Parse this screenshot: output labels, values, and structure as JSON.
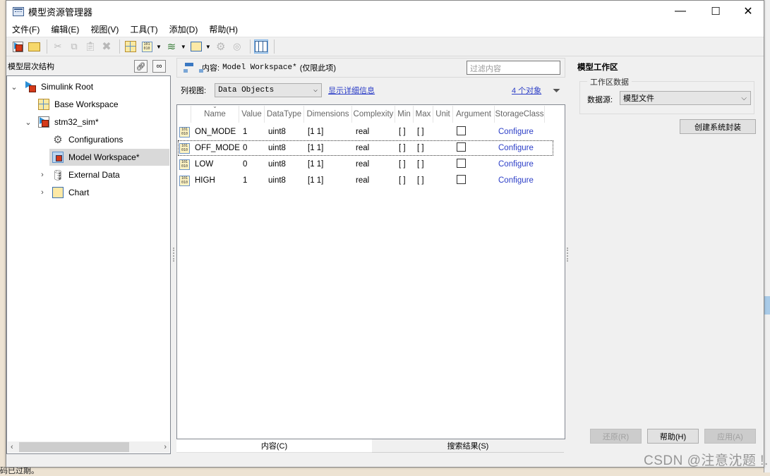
{
  "window": {
    "title": "模型资源管理器",
    "controls": {
      "minimize": "—",
      "maximize": "☐",
      "close": "✕"
    }
  },
  "menubar": [
    "文件(F)",
    "编辑(E)",
    "视图(V)",
    "工具(T)",
    "添加(D)",
    "帮助(H)"
  ],
  "toolbar": {
    "icons": [
      "new-model-icon",
      "open-folder-icon",
      "cut-icon",
      "copy-icon",
      "paste-icon",
      "delete-icon",
      "base-workspace-icon",
      "add-data-icon",
      "add-signal-icon",
      "add-block-icon",
      "config-icon",
      "config-ref-icon",
      "column-view-icon"
    ]
  },
  "hierarchy": {
    "title": "模型层次结构",
    "items": [
      {
        "label": "Simulink Root",
        "expanded": true,
        "level": 0
      },
      {
        "label": "Base Workspace",
        "level": 1
      },
      {
        "label": "stm32_sim*",
        "expanded": true,
        "level": 1
      },
      {
        "label": "Configurations",
        "level": 2
      },
      {
        "label": "Model Workspace*",
        "level": 2,
        "selected": true
      },
      {
        "label": "External Data",
        "expanded": false,
        "level": 2
      },
      {
        "label": "Chart",
        "expanded": false,
        "level": 2
      }
    ]
  },
  "contents": {
    "label_prefix": "内容:",
    "label_value": "Model Workspace*",
    "label_suffix": "(仅限此项)",
    "filter_placeholder": "过滤内容",
    "column_view_label": "列视图:",
    "column_view_value": "Data Objects",
    "show_details_link": "显示详细信息",
    "object_count_link": "4 个对象",
    "columns": [
      "",
      "Name",
      "Value",
      "DataType",
      "Dimensions",
      "Complexity",
      "Min",
      "Max",
      "Unit",
      "Argument",
      "StorageClass"
    ],
    "rows": [
      {
        "name": "ON_MODE",
        "value": "1",
        "datatype": "uint8",
        "dimensions": "[1 1]",
        "complexity": "real",
        "min": "[ ]",
        "max": "[ ]",
        "unit": "",
        "argument": false,
        "storage": "Configure"
      },
      {
        "name": "OFF_MODE",
        "value": "0",
        "datatype": "uint8",
        "dimensions": "[1 1]",
        "complexity": "real",
        "min": "[ ]",
        "max": "[ ]",
        "unit": "",
        "argument": false,
        "storage": "Configure"
      },
      {
        "name": "LOW",
        "value": "0",
        "datatype": "uint8",
        "dimensions": "[1 1]",
        "complexity": "real",
        "min": "[ ]",
        "max": "[ ]",
        "unit": "",
        "argument": false,
        "storage": "Configure"
      },
      {
        "name": "HIGH",
        "value": "1",
        "datatype": "uint8",
        "dimensions": "[1 1]",
        "complexity": "real",
        "min": "[ ]",
        "max": "[ ]",
        "unit": "",
        "argument": false,
        "storage": "Configure"
      }
    ],
    "tabs": [
      "内容(C)",
      "搜索结果(S)"
    ]
  },
  "dialog": {
    "title": "模型工作区",
    "group_label": "工作区数据",
    "source_label": "数据源:",
    "source_value": "模型文件",
    "create_wrapper_button": "创建系统封装",
    "revert_button": "还原(R)",
    "help_button": "帮助(H)",
    "apply_button": "应用(A)"
  },
  "background_text": "码已过期。",
  "watermark": "CSDN @注意沈题 !."
}
